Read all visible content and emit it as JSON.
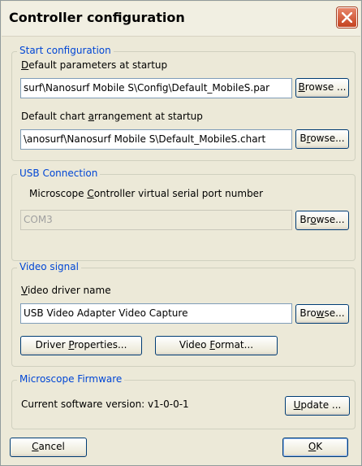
{
  "window": {
    "title": "Controller configuration"
  },
  "start_config": {
    "group_title": "Start configuration",
    "params_label_ul": "D",
    "params_label_rest": "efault parameters at startup",
    "params_value": "surf\\Nanosurf Mobile S\\Config\\Default_MobileS.par",
    "params_browse_pre": "",
    "params_browse_ul": "B",
    "params_browse_post": "rowse ...",
    "chart_label_pre": "Default chart ",
    "chart_label_ul": "a",
    "chart_label_post": "rrangement at startup",
    "chart_value": "\\anosurf\\Nanosurf Mobile S\\Default_MobileS.chart",
    "chart_browse_pre": "B",
    "chart_browse_ul": "r",
    "chart_browse_post": "owse..."
  },
  "usb": {
    "group_title": "USB Connection",
    "port_label_pre": "Microscope ",
    "port_label_ul": "C",
    "port_label_post": "ontroller virtual serial port number",
    "port_value": "COM3",
    "browse_pre": "Br",
    "browse_ul": "o",
    "browse_post": "wse..."
  },
  "video": {
    "group_title": "Video signal",
    "driver_label_ul": "V",
    "driver_label_rest": "ideo driver name",
    "driver_value": "USB Video Adapter Video Capture",
    "browse_pre": "Bro",
    "browse_ul": "w",
    "browse_post": "se...",
    "props_pre": "Driver ",
    "props_ul": "P",
    "props_post": "roperties...",
    "format_pre": "Video ",
    "format_ul": "F",
    "format_post": "ormat..."
  },
  "firmware": {
    "group_title": "Microscope Firmware",
    "version_text": "Current software version: v1-0-0-1",
    "update_ul": "U",
    "update_post": "pdate ..."
  },
  "footer": {
    "cancel_ul": "C",
    "cancel_post": "ancel",
    "ok_ul": "O",
    "ok_post": "K"
  }
}
